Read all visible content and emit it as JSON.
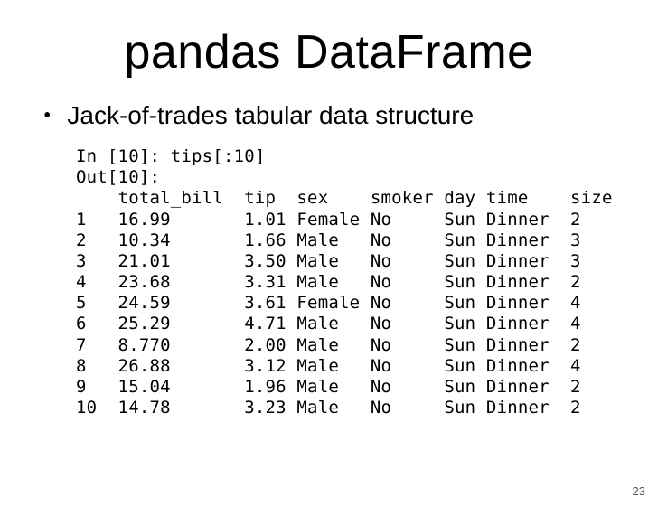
{
  "title": "pandas DataFrame",
  "bullet_text": "Jack-of-trades tabular data structure",
  "code": {
    "input_label": "In [10]: tips[:10]",
    "output_label": "Out[10]:",
    "header": {
      "idx": "   ",
      "total_bill": "total_bill",
      "tip": "tip",
      "sex": "sex",
      "smoker": "smoker",
      "day": "day",
      "time": "time",
      "size": "size"
    },
    "rows": [
      {
        "idx": "1",
        "total_bill": "16.99",
        "tip": "1.01",
        "sex": "Female",
        "smoker": "No",
        "day": "Sun",
        "time": "Dinner",
        "size": "2"
      },
      {
        "idx": "2",
        "total_bill": "10.34",
        "tip": "1.66",
        "sex": "Male",
        "smoker": "No",
        "day": "Sun",
        "time": "Dinner",
        "size": "3"
      },
      {
        "idx": "3",
        "total_bill": "21.01",
        "tip": "3.50",
        "sex": "Male",
        "smoker": "No",
        "day": "Sun",
        "time": "Dinner",
        "size": "3"
      },
      {
        "idx": "4",
        "total_bill": "23.68",
        "tip": "3.31",
        "sex": "Male",
        "smoker": "No",
        "day": "Sun",
        "time": "Dinner",
        "size": "2"
      },
      {
        "idx": "5",
        "total_bill": "24.59",
        "tip": "3.61",
        "sex": "Female",
        "smoker": "No",
        "day": "Sun",
        "time": "Dinner",
        "size": "4"
      },
      {
        "idx": "6",
        "total_bill": "25.29",
        "tip": "4.71",
        "sex": "Male",
        "smoker": "No",
        "day": "Sun",
        "time": "Dinner",
        "size": "4"
      },
      {
        "idx": "7",
        "total_bill": "8.770",
        "tip": "2.00",
        "sex": "Male",
        "smoker": "No",
        "day": "Sun",
        "time": "Dinner",
        "size": "2"
      },
      {
        "idx": "8",
        "total_bill": "26.88",
        "tip": "3.12",
        "sex": "Male",
        "smoker": "No",
        "day": "Sun",
        "time": "Dinner",
        "size": "4"
      },
      {
        "idx": "9",
        "total_bill": "15.04",
        "tip": "1.96",
        "sex": "Male",
        "smoker": "No",
        "day": "Sun",
        "time": "Dinner",
        "size": "2"
      },
      {
        "idx": "10",
        "total_bill": "14.78",
        "tip": "3.23",
        "sex": "Male",
        "smoker": "No",
        "day": "Sun",
        "time": "Dinner",
        "size": "2"
      }
    ]
  },
  "page_number": "23"
}
